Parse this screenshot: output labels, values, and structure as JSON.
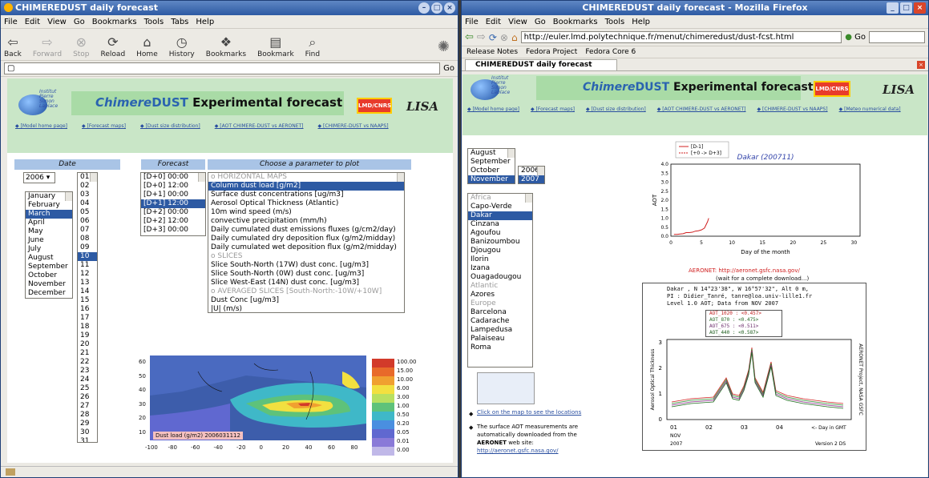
{
  "left": {
    "title": "CHIMEREDUST daily forecast",
    "menu": [
      "File",
      "Edit",
      "View",
      "Go",
      "Bookmarks",
      "Tools",
      "Tabs",
      "Help"
    ],
    "toolbar": {
      "back": "Back",
      "forward": "Forward",
      "stop": "Stop",
      "reload": "Reload",
      "home": "Home",
      "history": "History",
      "bookmarks": "Bookmarks",
      "bookmark": "Bookmark",
      "find": "Find"
    },
    "go": "Go",
    "labels": {
      "date": "Date",
      "forecast": "Forecast",
      "param": "Choose a parameter to plot"
    },
    "year": "2006",
    "months": [
      "January",
      "February",
      "March",
      "April",
      "May",
      "June",
      "July",
      "August",
      "September",
      "October",
      "November",
      "December"
    ],
    "days": [
      "01",
      "02",
      "03",
      "04",
      "05",
      "06",
      "07",
      "08",
      "09",
      "10",
      "11",
      "12",
      "13",
      "14",
      "15",
      "16",
      "17",
      "18",
      "19",
      "20",
      "21",
      "22",
      "23",
      "24",
      "25",
      "26",
      "27",
      "28",
      "29",
      "30",
      "31"
    ],
    "forecasts": [
      "[D+0]  00:00",
      "[D+0]  12:00",
      "[D+1]  00:00",
      "[D+1]  12:00",
      "[D+2]  00:00",
      "[D+2]  12:00",
      "[D+3]  00:00"
    ],
    "params": [
      {
        "t": "o HORIZONTAL MAPS",
        "g": true
      },
      {
        "t": "Column dust load [g/m2]",
        "s": true
      },
      {
        "t": "Surface dust concentrations [ug/m3]"
      },
      {
        "t": "Aerosol Optical Thickness (Atlantic)"
      },
      {
        "t": "10m wind speed (m/s)"
      },
      {
        "t": "convective precipitation (mm/h)"
      },
      {
        "t": "Daily cumulated dust emissions fluxes (g/cm2/day)"
      },
      {
        "t": "Daily cumulated dry deposition flux (g/m2/midday)"
      },
      {
        "t": "Daily cumulated wet deposition flux (g/m2/midday)"
      },
      {
        "t": "o SLICES",
        "g": true
      },
      {
        "t": "Slice South-North (17W) dust conc. [ug/m3]"
      },
      {
        "t": "Slice South-North (0W) dust conc. [ug/m3]"
      },
      {
        "t": "Slice West-East (14N) dust conc. [ug/m3]"
      },
      {
        "t": "o AVERAGED SLICES [South-North:-10W/+10W]",
        "g": true
      },
      {
        "t": "Dust Conc [ug/m3]"
      },
      {
        "t": "|U| (m/s)"
      }
    ],
    "map": {
      "caption": "Dust load (g/m2)  2006031112",
      "xticks": [
        "-100",
        "-80",
        "-60",
        "-40",
        "-20",
        "0",
        "20",
        "40",
        "60",
        "80"
      ],
      "yticks": [
        "60",
        "50",
        "40",
        "30",
        "20",
        "10"
      ],
      "legend": [
        "100.00",
        "15.00",
        "10.00",
        "6.00",
        "3.00",
        "1.00",
        "0.50",
        "0.20",
        "0.05",
        "0.01",
        "0.00"
      ],
      "colors": [
        "#d23a2a",
        "#e86a2a",
        "#f0a030",
        "#f2e040",
        "#b8e060",
        "#5ec27a",
        "#3fb8c8",
        "#4a8fe0",
        "#6068d0",
        "#8a7ad8",
        "#c0b8e8"
      ]
    }
  },
  "right": {
    "title": "CHIMEREDUST daily forecast - Mozilla Firefox",
    "menu": [
      "File",
      "Edit",
      "View",
      "Go",
      "Bookmarks",
      "Tools",
      "Help"
    ],
    "url": "http://euler.lmd.polytechnique.fr/menut/chimeredust/dust-fcst.html",
    "go": "Go",
    "bookmarks": [
      "Release Notes",
      "Fedora Project",
      "Fedora Core 6"
    ],
    "tab": "CHIMEREDUST daily forecast",
    "links": [
      "[Model home page]",
      "[Forecast maps]",
      "[Dust size distribution]",
      "[AOT CHIMERE-DUST vs AERONET]",
      "[CHIMERE-DUST vs NAAPS]",
      "[Meteo numerical data]"
    ],
    "months": [
      "August",
      "September",
      "October",
      "November"
    ],
    "years": [
      "2006",
      "2007"
    ],
    "stations": [
      {
        "t": "Africa",
        "g": true
      },
      {
        "t": "Capo-Verde"
      },
      {
        "t": "Dakar",
        "s": true
      },
      {
        "t": "Cinzana"
      },
      {
        "t": "Agoufou"
      },
      {
        "t": "Banizoumbou"
      },
      {
        "t": "Djougou"
      },
      {
        "t": "Ilorin"
      },
      {
        "t": "Izana"
      },
      {
        "t": "Ouagadougou"
      },
      {
        "t": "Atlantic",
        "g": true
      },
      {
        "t": "Azores"
      },
      {
        "t": "Europe",
        "g": true
      },
      {
        "t": "Barcelona"
      },
      {
        "t": "Cadarache"
      },
      {
        "t": "Lampedusa"
      },
      {
        "t": "Palaiseau"
      },
      {
        "t": "Roma"
      }
    ],
    "aeronet_link": "AERONET: http://aeronet.gsfc.nasa.gov/",
    "wait": "(wait for a complete download...)",
    "map_link": "Click on the map to see the locations",
    "note": "The surface AOT measurements are automatically downloaded from the",
    "aeronet_web": "AERONET",
    "web_site": " web site:",
    "aeronet_url": "http://aeronet.gsfc.nasa.gov/",
    "plot2": {
      "header1": "Dakar , N 14°23'38\", W 16°57'32\", Alt 0 m,",
      "header2": "PI : Didier_Tanré, tanre@loa.univ-lille1.fr",
      "header3": "Level 1.0 AOT; Data from NOV 2007",
      "legend": [
        "AOT_1020  : <0.457>",
        "AOT_870   : <0.475>",
        "AOT_675   : <0.511>",
        "AOT_440   : <0.587>"
      ],
      "ylabel": "Aerosol Optical Thickness",
      "right": "AERONET Project, NASA GSFC",
      "xticks": [
        "01",
        "02",
        "03",
        "04"
      ],
      "xnote": "<- Day in GMT",
      "month": "NOV",
      "year": "2007",
      "version": "Version 2 DS",
      "yticks": [
        "3",
        "2",
        "1",
        "0"
      ]
    }
  },
  "chart_data": {
    "type": "line",
    "title": "Dakar (200711)",
    "xlabel": "Day of the month",
    "ylabel": "AOT",
    "xlim": [
      0,
      31
    ],
    "ylim": [
      0,
      4.0
    ],
    "xticks": [
      "0",
      "5",
      "10",
      "15",
      "20",
      "25",
      "30"
    ],
    "yticks": [
      "0.0",
      "0.5",
      "1.0",
      "1.5",
      "2.0",
      "2.5",
      "3.0",
      "3.5",
      "4.0"
    ],
    "legend": [
      "[D-1]",
      "[+0 -> D+3]"
    ],
    "series": [
      {
        "name": "[D-1]",
        "x": [
          0.5,
          1,
          1.5,
          2,
          2.5,
          3,
          3.5,
          4,
          4.5,
          5,
          5.5,
          6,
          6.2
        ],
        "y": [
          0.1,
          0.1,
          0.12,
          0.14,
          0.2,
          0.2,
          0.22,
          0.28,
          0.3,
          0.35,
          0.45,
          0.8,
          1.0
        ]
      }
    ]
  }
}
